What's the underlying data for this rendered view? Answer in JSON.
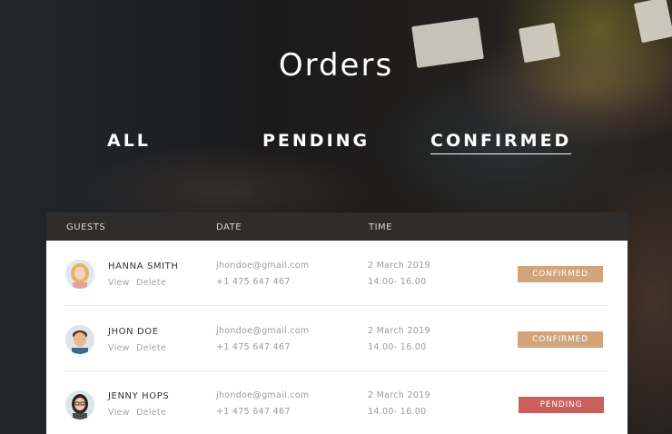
{
  "page_title": "Orders",
  "tabs": [
    {
      "label": "ALL",
      "active": false
    },
    {
      "label": "PENDING",
      "active": false
    },
    {
      "label": "CONFIRMED",
      "active": true
    }
  ],
  "table": {
    "headers": [
      "GUESTS",
      "DATE",
      "TIME"
    ],
    "rows": [
      {
        "name": "HANNA SMITH",
        "action_view": "View",
        "action_delete": "Delete",
        "email": "jhondoe@gmail.com",
        "phone": "+1 475 647 467",
        "date": "2 March 2019",
        "time": "14.00- 16.00",
        "status": "CONFIRMED",
        "avatar_icon": "woman-blonde-avatar"
      },
      {
        "name": "JHON DOE",
        "action_view": "View",
        "action_delete": "Delete",
        "email": "jhondoe@gmail.com",
        "phone": "+1 475 647 467",
        "date": "2 March 2019",
        "time": "14.00- 16.00",
        "status": "CONFIRMED",
        "avatar_icon": "man-smiling-avatar"
      },
      {
        "name": "JENNY HOPS",
        "action_view": "View",
        "action_delete": "Delete",
        "email": "jhondoe@gmail.com",
        "phone": "+1 475 647 467",
        "date": "2 March 2019",
        "time": "14.00- 16.00",
        "status": "PENDING",
        "avatar_icon": "woman-glasses-avatar"
      }
    ]
  },
  "colors": {
    "confirmed": "#d2a47c",
    "pending": "#c9605e",
    "header_bg": "#2e2d2c"
  }
}
